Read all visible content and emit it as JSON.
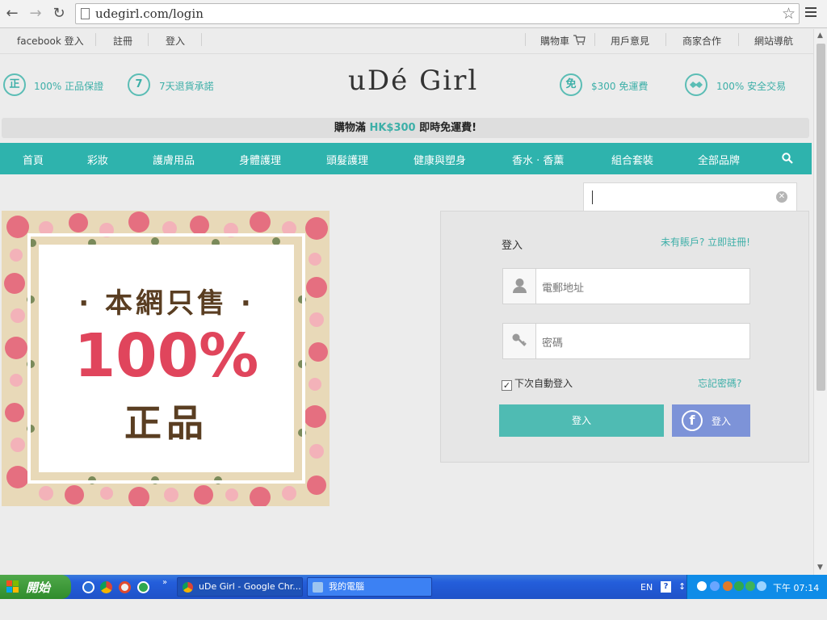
{
  "browser": {
    "url": "udegirl.com/login"
  },
  "topbar": {
    "left_links": [
      "facebook 登入",
      "註冊",
      "登入"
    ],
    "right_links": [
      "購物車",
      "用戶意見",
      "商家合作",
      "網站導航"
    ]
  },
  "features": [
    {
      "badge": "正",
      "text": "100% 正品保證"
    },
    {
      "badge": "7",
      "text": "7天退貨承諾"
    },
    {
      "badge": "免",
      "text": "$300 免運費"
    },
    {
      "badge": "",
      "text": "100% 安全交易"
    }
  ],
  "logo": "uDé Girl",
  "promo": {
    "prefix": "購物滿 ",
    "highlight": "HK$300",
    "suffix": " 即時免運費!"
  },
  "nav": {
    "items": [
      "首頁",
      "彩妝",
      "護膚用品",
      "身體護理",
      "頭髮護理",
      "健康與塑身",
      "香水 · 香薰",
      "組合套裝",
      "全部品牌"
    ]
  },
  "banner": {
    "line1": "· 本網只售 ·",
    "line2": "100%",
    "line3": "正品"
  },
  "login": {
    "title": "登入",
    "register_link": "未有賬戶? 立即註冊!",
    "email_placeholder": "電郵地址",
    "password_placeholder": "密碼",
    "remember_label": "下次自動登入",
    "remember_checked": true,
    "forgot_link": "忘記密碼?",
    "submit_label": "登入",
    "facebook_label": "登入"
  },
  "taskbar": {
    "start_label": "開始",
    "tasks": [
      {
        "label": "uDe Girl - Google Chr...",
        "active": true
      },
      {
        "label": "我的電腦",
        "active": false
      }
    ],
    "lang": "EN",
    "clock": "下午 07:14"
  },
  "colors": {
    "accent": "#2eb3ad",
    "facebook": "#7d93d8",
    "banner_red": "#e0455c"
  }
}
